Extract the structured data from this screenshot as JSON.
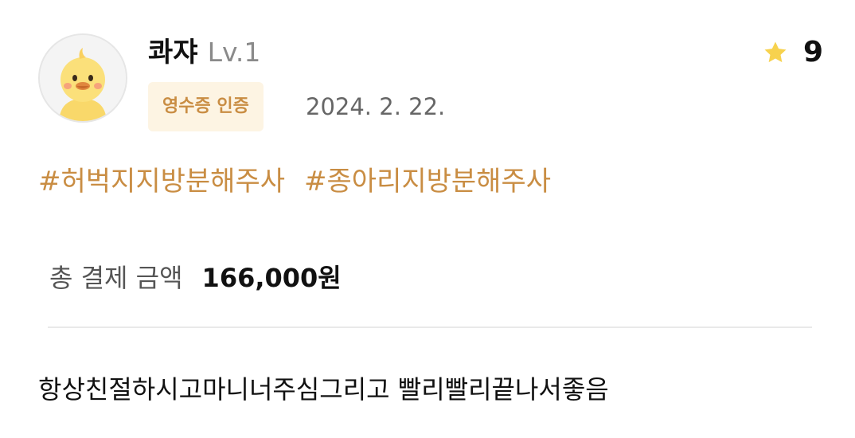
{
  "user": {
    "name": "콰쟈",
    "level": "Lv.1",
    "avatar_icon": "duck-chick-icon"
  },
  "badge": {
    "label": "영수증 인증"
  },
  "date": "2024. 2. 22.",
  "rating": {
    "icon": "star-icon",
    "value": "9",
    "star_color": "#f7d24e"
  },
  "tags": [
    "#허벅지지방분해주사",
    "#종아리지방분해주사"
  ],
  "payment": {
    "label": "총 결제 금액",
    "amount": "166,000원"
  },
  "review": {
    "text": "항상친절하시고마니너주심그리고 빨리빨리끝나서좋음"
  },
  "colors": {
    "accent": "#c98d43",
    "badge_bg": "#fdf4e3"
  }
}
